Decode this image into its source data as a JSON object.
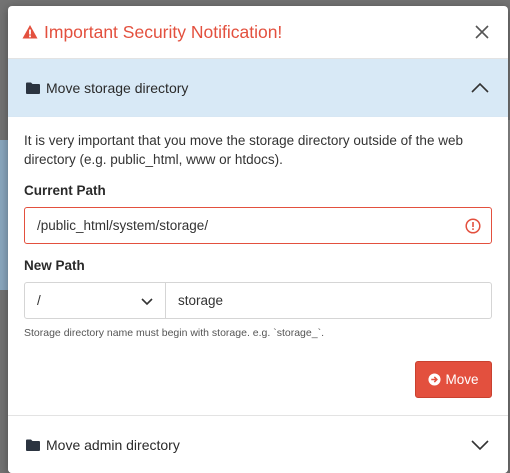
{
  "modal": {
    "title": "Important Security Notification!",
    "accent_color": "#e3503e"
  },
  "sections": [
    {
      "title": "Move storage directory",
      "expanded": true,
      "description": "It is very important that you move the storage directory outside of the web directory (e.g. public_html, www or htdocs).",
      "current_path_label": "Current Path",
      "current_path_value": "/public_html/system/storage/",
      "new_path_label": "New Path",
      "new_path_select": "/",
      "new_path_name": "storage",
      "help": "Storage directory name must begin with storage. e.g. `storage_`.",
      "button": "Move"
    },
    {
      "title": "Move admin directory",
      "expanded": false
    }
  ]
}
